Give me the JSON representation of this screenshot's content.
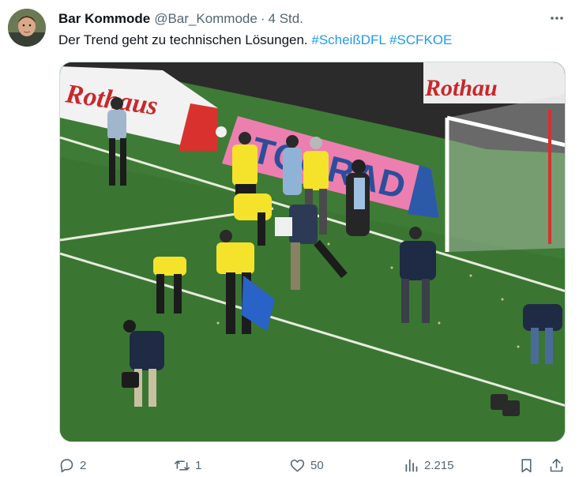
{
  "author": {
    "name": "Bar Kommode",
    "handle": "@Bar_Kommode",
    "separator": "·",
    "time": "4 Std."
  },
  "tweet": {
    "text": "Der Trend geht zu technischen Lösungen.",
    "hashtags": [
      "#ScheißDFL",
      "#SCFKOE"
    ]
  },
  "media": {
    "banner_left": "Rothaus",
    "banner_pink": "TOORAD",
    "banner_right": "Rothau"
  },
  "actions": {
    "replies": "2",
    "reposts": "1",
    "likes": "50",
    "views": "2.215"
  },
  "colors": {
    "hashtag": "#1d9bf0",
    "secondary_text": "#536471",
    "pitch": "#3d7a35",
    "vest": "#f4e32a"
  },
  "icons": [
    "more-icon",
    "reply-icon",
    "repost-icon",
    "like-icon",
    "views-icon",
    "bookmark-icon",
    "share-icon"
  ]
}
